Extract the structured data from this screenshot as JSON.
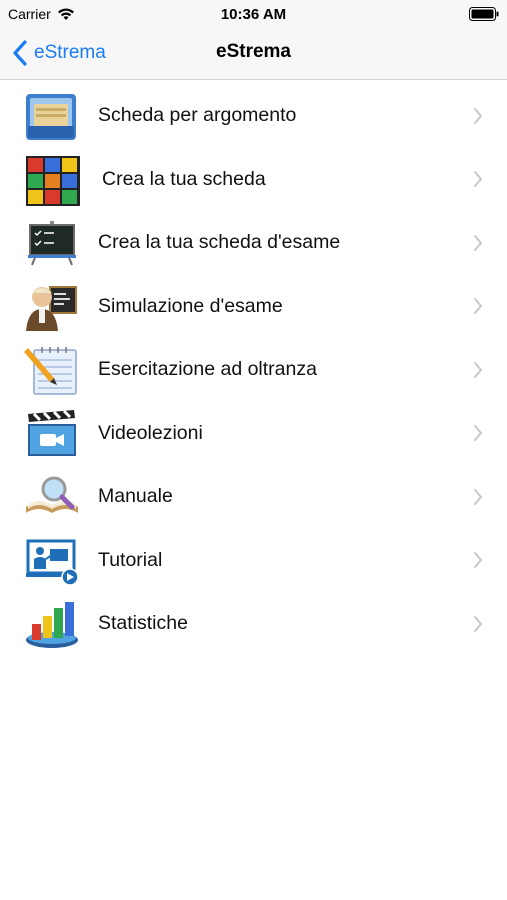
{
  "status_bar": {
    "carrier": "Carrier",
    "time": "10:36 AM"
  },
  "nav": {
    "back_label": "eStrema",
    "title": "eStrema"
  },
  "menu": [
    {
      "label": "Scheda per argomento",
      "icon": "folder-icon"
    },
    {
      "label": "Crea la tua scheda",
      "icon": "quiz-cube-icon"
    },
    {
      "label": "Crea la tua scheda d'esame",
      "icon": "blackboard-icon"
    },
    {
      "label": "Simulazione d'esame",
      "icon": "professor-icon"
    },
    {
      "label": "Esercitazione ad oltranza",
      "icon": "notepad-pencil-icon"
    },
    {
      "label": "Videolezioni",
      "icon": "clapperboard-icon"
    },
    {
      "label": "Manuale",
      "icon": "book-magnifier-icon"
    },
    {
      "label": "Tutorial",
      "icon": "presentation-icon"
    },
    {
      "label": "Statistiche",
      "icon": "chart-icon"
    }
  ],
  "colors": {
    "accent": "#1a7cf6",
    "bar_background": "#f7f7f7",
    "chevron": "#c7c7cc"
  }
}
